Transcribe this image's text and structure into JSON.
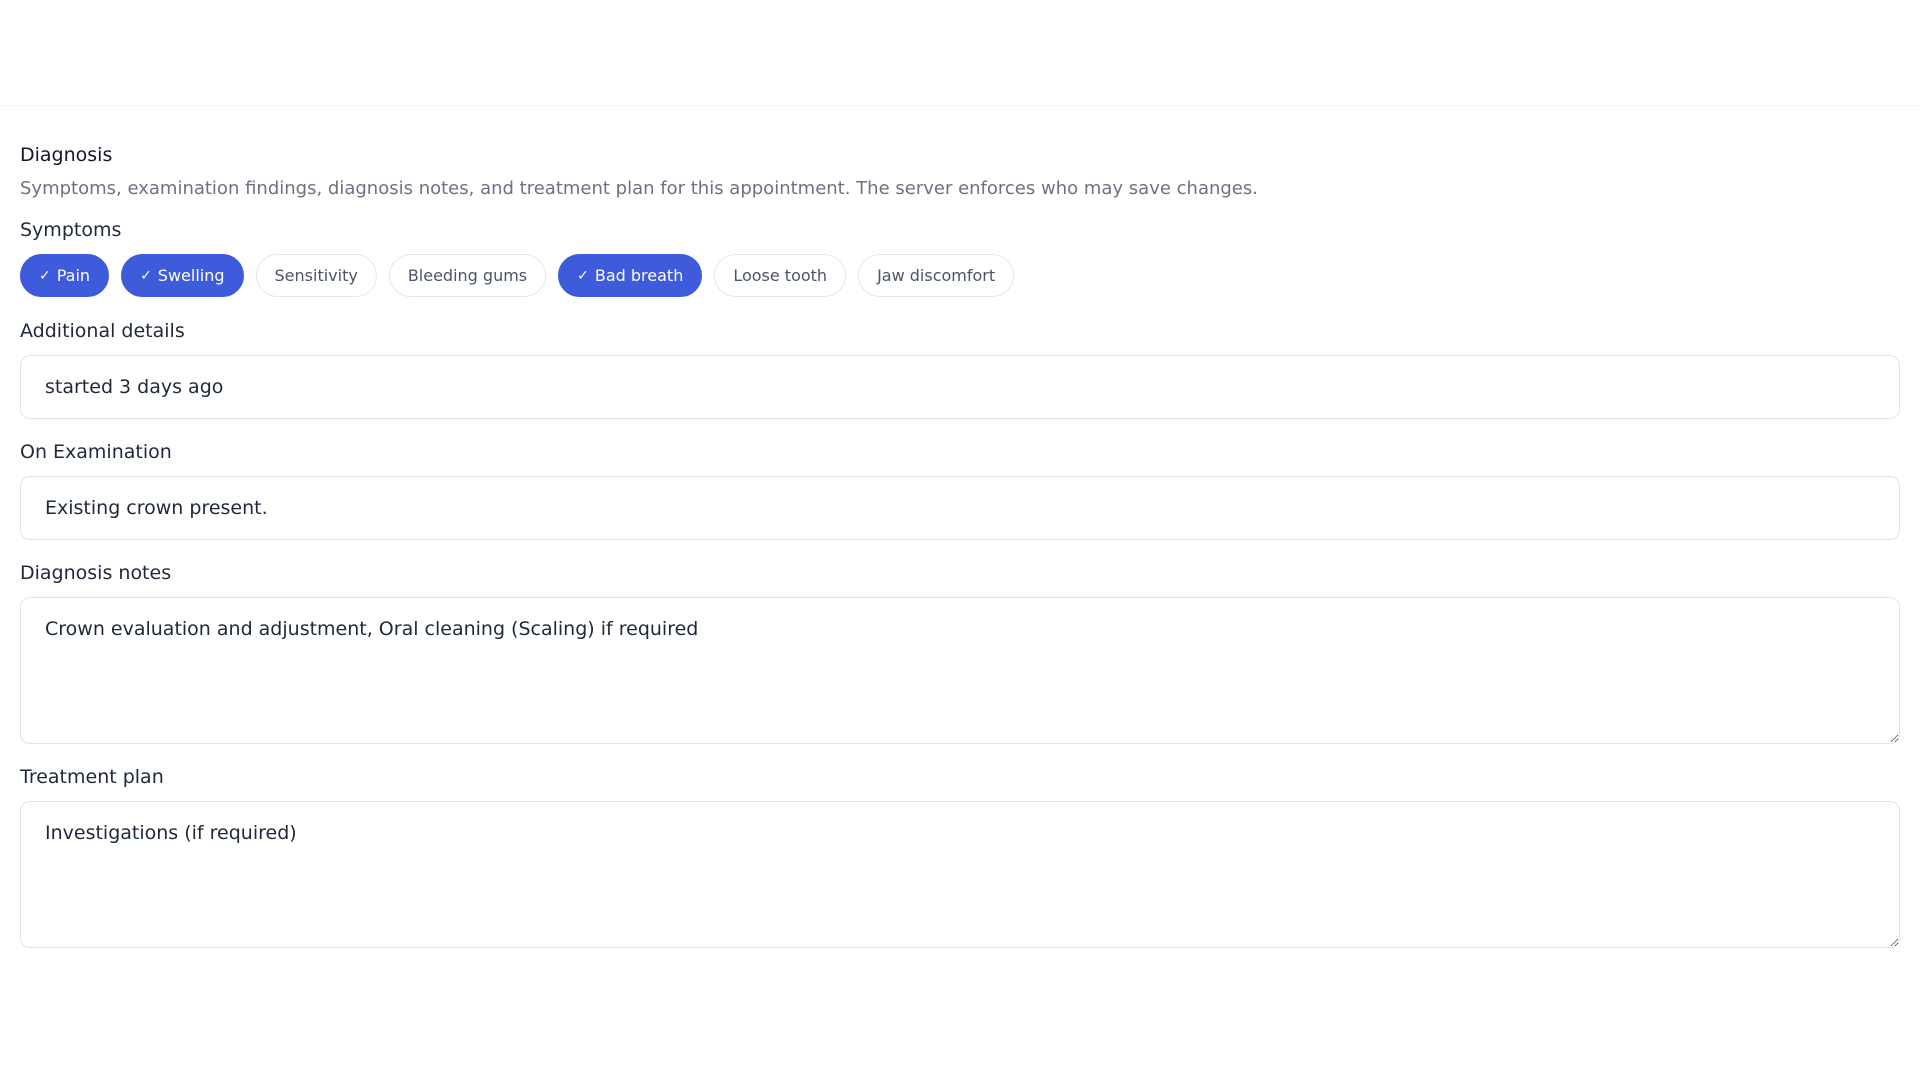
{
  "section": {
    "title": "Diagnosis",
    "description": "Symptoms, examination findings, diagnosis notes, and treatment plan for this appointment. The server enforces who may save changes."
  },
  "symptoms": {
    "label": "Symptoms",
    "items": [
      {
        "label": "Pain",
        "selected": true
      },
      {
        "label": "Swelling",
        "selected": true
      },
      {
        "label": "Sensitivity",
        "selected": false
      },
      {
        "label": "Bleeding gums",
        "selected": false
      },
      {
        "label": "Bad breath",
        "selected": true
      },
      {
        "label": "Loose tooth",
        "selected": false
      },
      {
        "label": "Jaw discomfort",
        "selected": false
      }
    ],
    "check_icon": "check-icon",
    "selected_color": "#3d5bdb"
  },
  "additional_details": {
    "label": "Additional details",
    "value": "started 3 days ago"
  },
  "on_examination": {
    "label": "On Examination",
    "value": "Existing crown present."
  },
  "diagnosis_notes": {
    "label": "Diagnosis notes",
    "value": "Crown evaluation and adjustment, Oral cleaning (Scaling) if required"
  },
  "treatment_plan": {
    "label": "Treatment plan",
    "value": "Investigations (if required)"
  }
}
